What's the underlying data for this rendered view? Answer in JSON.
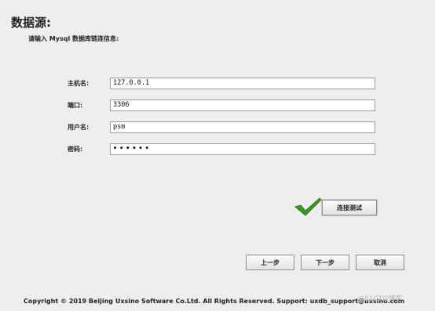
{
  "header": {
    "title": "数据源:",
    "subtitle": "请输入 Mysql 数据库链连信息:"
  },
  "form": {
    "host": {
      "label": "主机名:",
      "value": "127.0.0.1"
    },
    "port": {
      "label": "端口:",
      "value": "3306"
    },
    "user": {
      "label": "用户名:",
      "value": "psm"
    },
    "password": {
      "label": "密码:",
      "value": "••••••"
    }
  },
  "connection_test": {
    "label": "连接测试",
    "status_icon": "check-icon",
    "status_color": "#3a9a1f"
  },
  "nav": {
    "prev_label": "上一步",
    "next_label": "下一步",
    "cancel_label": "取消"
  },
  "footer": {
    "text": "Copyright © 2019 Beijing Uxsino Software Co.Ltd. All Rights Reserved.  Support:  uxdb_support@uxsino.com"
  },
  "watermark": "@51CTO博客"
}
